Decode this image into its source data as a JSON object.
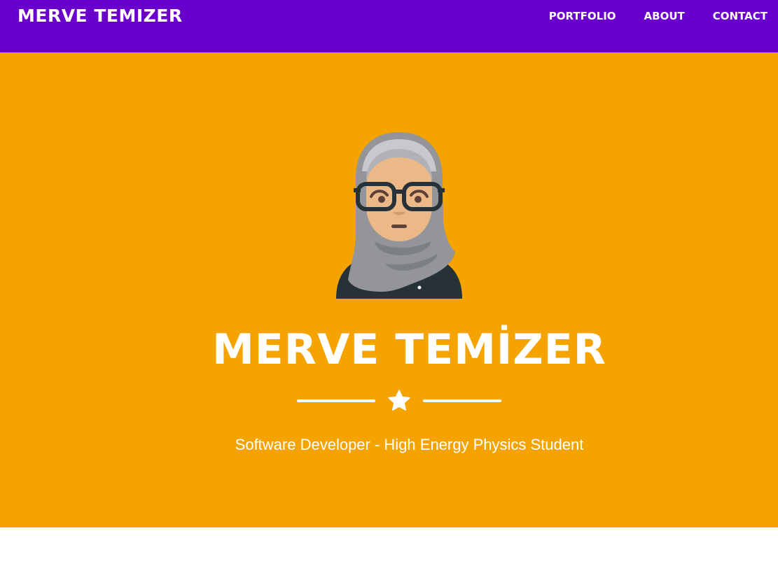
{
  "header": {
    "brand": "MERVE TEMIZER",
    "nav": [
      "PORTFOLIO",
      "ABOUT",
      "CONTACT"
    ]
  },
  "hero": {
    "title": "MERVE TEMİZER",
    "subtitle": "Software Developer - High Energy Physics Student",
    "avatar_icon": "woman-hijab-glasses-avatar",
    "divider_icon": "star-icon"
  },
  "colors": {
    "navbar": "#6a00cc",
    "hero_background": "#f4a300",
    "text": "#ffffff"
  }
}
